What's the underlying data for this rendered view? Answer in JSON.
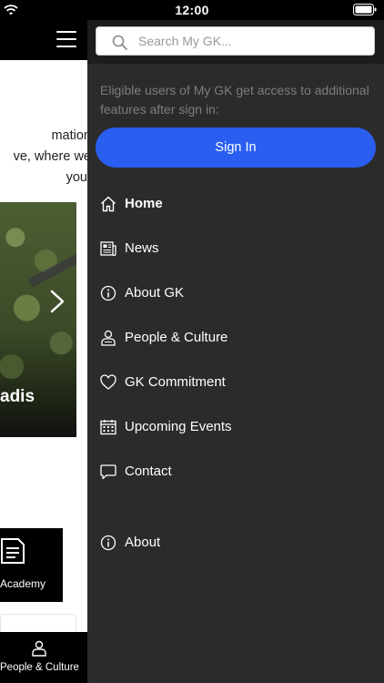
{
  "status_bar": {
    "time": "12:00"
  },
  "background_page": {
    "text_lines": [
      "mation",
      "ve, where we",
      "you."
    ],
    "hero_caption": "adis",
    "academy_label": "Academy",
    "bottom_tab_label": "People & Culture"
  },
  "drawer": {
    "search_placeholder": "Search My GK...",
    "signin_note": "Eligible users of My GK get access to additional features after sign in:",
    "signin_label": "Sign In",
    "menu": [
      {
        "label": "Home",
        "icon": "home-icon",
        "active": true
      },
      {
        "label": "News",
        "icon": "news-icon"
      },
      {
        "label": "About GK",
        "icon": "info-icon"
      },
      {
        "label": "People & Culture",
        "icon": "person-icon"
      },
      {
        "label": "GK Commitment",
        "icon": "heart-icon"
      },
      {
        "label": "Upcoming Events",
        "icon": "calendar-icon"
      },
      {
        "label": "Contact",
        "icon": "chat-bubble-icon"
      }
    ],
    "about": {
      "label": "About",
      "icon": "info-icon"
    }
  },
  "colors": {
    "drawer_bg": "#2b2b2b",
    "search_bar_bg": "#1d1d1d",
    "accent_blue": "#2a5ef0",
    "muted_text": "#7d7d7d"
  }
}
